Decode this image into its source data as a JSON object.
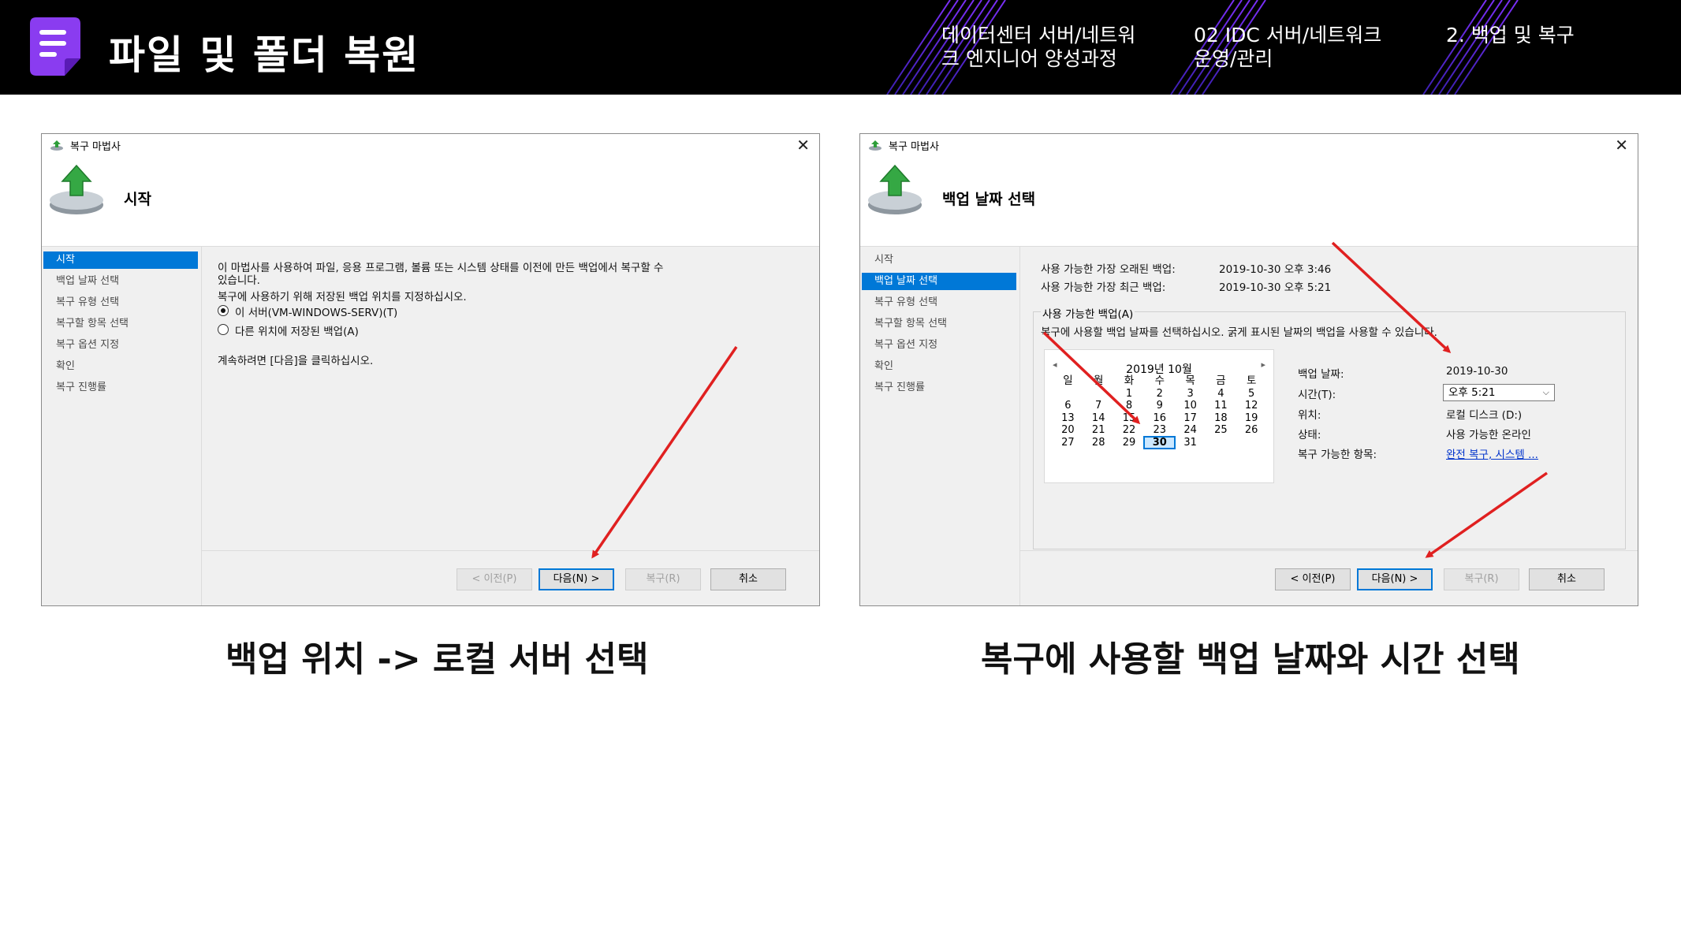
{
  "header": {
    "title": "파일 및 폴더 복원",
    "course_line1": "데이터센터 서버/네트워",
    "course_line2": "크 엔지니어 양성과정",
    "module_line1": "02 IDC 서버/네트워크",
    "module_line2": "운영/관리",
    "section": "2. 백업 및 복구"
  },
  "wizard": {
    "window_title": "복구 마법사",
    "steps": [
      "시작",
      "백업 날짜 선택",
      "복구 유형 선택",
      "복구할 항목 선택",
      "복구 옵션 지정",
      "확인",
      "복구 진행률"
    ],
    "buttons": {
      "prev": "< 이전(P)",
      "next": "다음(N) >",
      "recover": "복구(R)",
      "cancel": "취소"
    }
  },
  "left_window": {
    "heading": "시작",
    "active_step": 0,
    "intro_line1": "이 마법사를 사용하여 파일, 응용 프로그램, 볼륨 또는 시스템 상태를 이전에 만든 백업에서 복구할 수",
    "intro_line2": "있습니다.",
    "location_prompt": "복구에 사용하기 위해 저장된 백업 위치를 지정하십시오.",
    "option_this_server": "이 서버(VM-WINDOWS-SERV)(T)",
    "option_other_location": "다른 위치에 저장된 백업(A)",
    "continue_hint": "계속하려면 [다음]을 클릭하십시오."
  },
  "right_window": {
    "heading": "백업 날짜 선택",
    "active_step": 1,
    "oldest_label": "사용 가능한 가장 오래된 백업:",
    "oldest_value": "2019-10-30 오후 3:46",
    "newest_label": "사용 가능한 가장 최근 백업:",
    "newest_value": "2019-10-30 오후 5:21",
    "group_label": "사용 가능한 백업(A)",
    "group_instruction": "복구에 사용할 백업 날짜를 선택하십시오. 굵게 표시된 날짜의 백업을 사용할 수 있습니다.",
    "calendar": {
      "month_title": "2019년 10월",
      "prev_nav": "◂",
      "next_nav": "▸",
      "weekdays": [
        "일",
        "월",
        "화",
        "수",
        "목",
        "금",
        "토"
      ],
      "weeks": [
        [
          "",
          "",
          "1",
          "2",
          "3",
          "4",
          "5"
        ],
        [
          "6",
          "7",
          "8",
          "9",
          "10",
          "11",
          "12"
        ],
        [
          "13",
          "14",
          "15",
          "16",
          "17",
          "18",
          "19"
        ],
        [
          "20",
          "21",
          "22",
          "23",
          "24",
          "25",
          "26"
        ],
        [
          "27",
          "28",
          "29",
          "30",
          "31",
          "",
          ""
        ]
      ],
      "selected_day": "30"
    },
    "details": {
      "backup_date_label": "백업 날짜:",
      "backup_date_value": "2019-10-30",
      "time_label": "시간(T):",
      "time_value": "오후 5:21",
      "location_label": "위치:",
      "location_value": "로컬 디스크 (D:)",
      "status_label": "상태:",
      "status_value": "사용 가능한 온라인",
      "items_label": "복구 가능한 항목:",
      "items_value": "완전 복구, 시스템 ..."
    }
  },
  "captions": {
    "left": "백업 위치 -> 로컬 서버 선택",
    "right": "복구에 사용할 백업 날짜와 시간 선택"
  },
  "colors": {
    "header_bg": "#000000",
    "accent_purple": "#7b2ff7",
    "selection_blue": "#0078d7",
    "arrow_red": "#e02020"
  }
}
